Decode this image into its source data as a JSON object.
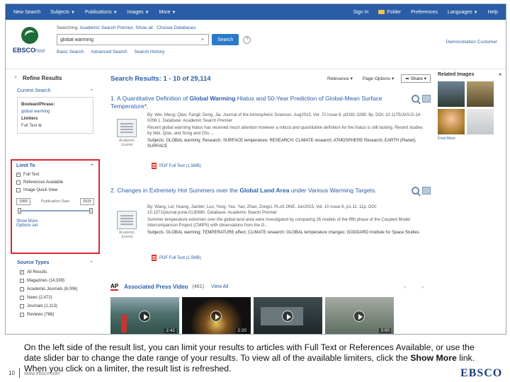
{
  "topnav": {
    "left": [
      "New Search",
      "Subjects",
      "Publications",
      "Images",
      "More"
    ],
    "right": [
      "Sign In",
      "Folder",
      "Preferences",
      "Languages",
      "Help"
    ]
  },
  "header": {
    "logo_text": "EBSCO",
    "logo_suffix": "host",
    "searching_label": "Searching:",
    "searching_db": "Academic Search Premier",
    "show_all": "Show all",
    "choose_db": "Choose Databases",
    "search_value": "global warming",
    "search_clear": "×",
    "search_button": "Search",
    "help": "?",
    "links": [
      "Basic Search",
      "Advanced Search",
      "Search History"
    ],
    "demo_customer": "Demonstration Customer"
  },
  "left": {
    "refine_title": "Refine Results",
    "collapse": "«",
    "current_search_title": "Current Search",
    "boolean_label": "Boolean/Phrase:",
    "boolean_value": "global warming",
    "limiters_label": "Limiters",
    "limiters_value": "Full Text",
    "limit_to_title": "Limit To",
    "limit_options": [
      {
        "label": "Full Text",
        "checked": true
      },
      {
        "label": "References Available",
        "checked": false
      },
      {
        "label": "Image Quick View",
        "checked": false
      }
    ],
    "date_from": "1950",
    "date_label": "Publication Date",
    "date_to": "2015",
    "show_more": "Show More",
    "options_set": "Options set",
    "source_types_title": "Source Types",
    "source_types": [
      "All Results",
      "Magazines (14,339)",
      "Academic Journals (6,006)",
      "News (2,472)",
      "Journals (1,113)",
      "Reviews (786)"
    ]
  },
  "main": {
    "results_title": "Search Results: 1 - 10 of 29,114",
    "relevance": "Relevance",
    "page_options": "Page Options",
    "share": "Share",
    "results": [
      {
        "num": "1.",
        "title_pre": "A Quantitative Definition of ",
        "title_bold": "Global Warming",
        "title_post": " Hiatus and 50-Year Prediction of Global-Mean Surface Temperature*.",
        "meta": "By: Wei, Meng; Qiao, Fangli; Deng, Jia. Journal of the Atmospheric Sciences. Aug2015, Vol. 72 Issue 8, p3281-3289. 9p. DOI: 10.1175/JAS-D-14-0296.1. Database: Academic Search Premier",
        "abstract": "Recent global warming hiatus has received much attention however a robust and quantitative definition for the hiatus is still lacking. Recent studies by Wei, Qiao, and Song and Chu ...",
        "subjects": "Subjects: GLOBAL warming; Research; SURFACE temperature; RESEARCH; CLIMATE research; ATMOSPHERE Research; EARTH (Planet); SURFACE",
        "thumb_caption": "Academic Journal",
        "pdf": "PDF Full Text (1.5MB)"
      },
      {
        "num": "2.",
        "title_pre": "Changes in Extremely Hot Summers over the ",
        "title_bold": "Global Land Area",
        "title_post": " under Various Warming Targets.",
        "meta": "By: Wang, Lei; Huang, Jianbin; Luo, Yong; Yao, Yao; Zhao, Zongci. PLoS ONE. Jun2015, Vol. 10 Issue 6, p1-11. 11p. DOI: 10.1371/journal.pone.0130880. Database: Academic Search Premier",
        "abstract": "Summer temperature extremes over the global land area were investigated by comparing 26 models of the fifth phase of the Coupled Model Intercomparison Project (CMIP5) with observations from the G...",
        "subjects": "Subjects: GLOBAL warming; TEMPERATURE effect; CLIMATE research; GLOBAL temperature changes; GODDARD Institute for Space Studies",
        "thumb_caption": "Academic Journal",
        "pdf": "PDF Full Text (1.5MB)"
      }
    ],
    "ap": {
      "logo": "AP",
      "title": "Associated Press Video",
      "count": "(461)",
      "view_all": "View All",
      "nav": "‹ ›",
      "videos": [
        "2:42",
        "2:20",
        "",
        "3:00"
      ]
    }
  },
  "right": {
    "related_title": "Related Images",
    "collapse": "»",
    "find_more": "Find More"
  },
  "caption": {
    "line": "On the left side of the result list, you can limit your results to articles with Full Text or References Available, or use the date slider bar to change the date range of your results. To view all of the available limiters, click the ",
    "bold": "Show More",
    "end": " link. When you click on a limiter, the result list is refreshed."
  },
  "footer": {
    "page": "10",
    "url": "www.ebsco.com",
    "logo": "EBSCO"
  }
}
